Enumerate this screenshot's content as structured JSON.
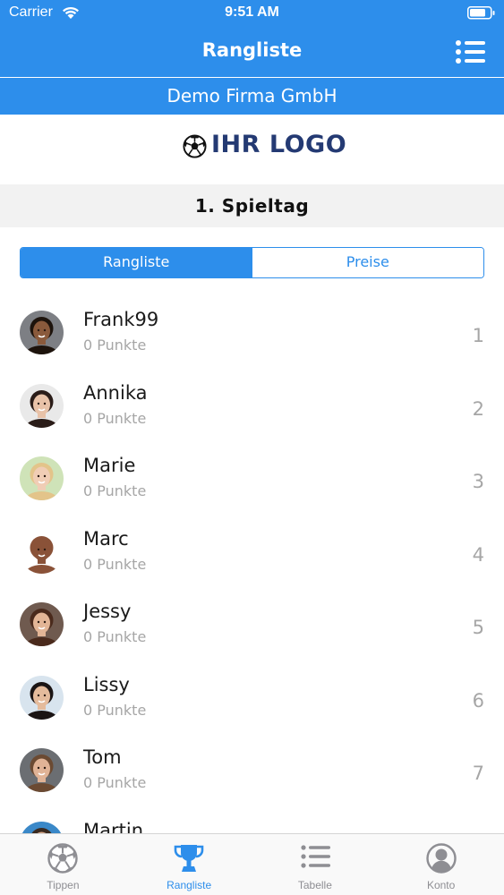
{
  "status_bar": {
    "carrier": "Carrier",
    "time": "9:51 AM"
  },
  "nav": {
    "title": "Rangliste",
    "menu_icon": "list-menu-icon"
  },
  "company": {
    "name": "Demo Firma GmbH"
  },
  "logo": {
    "text": "IHR LOGO",
    "icon": "soccer-ball-icon"
  },
  "matchday": {
    "title": "1. Spieltag"
  },
  "segments": [
    {
      "label": "Rangliste",
      "active": true
    },
    {
      "label": "Preise",
      "active": false
    }
  ],
  "players": [
    {
      "name": "Frank99",
      "points": "0 Punkte",
      "rank": "1",
      "skin": "#8a5a3c",
      "hair": "#1d130c",
      "bg": "#7d7f84"
    },
    {
      "name": "Annika",
      "points": "0 Punkte",
      "rank": "2",
      "skin": "#e8c2a8",
      "hair": "#2a1c18",
      "bg": "#e9e9e9"
    },
    {
      "name": "Marie",
      "points": "0 Punkte",
      "rank": "3",
      "skin": "#f0cdb5",
      "hair": "#e3c48a",
      "bg": "#cfe3b8"
    },
    {
      "name": "Marc",
      "points": "0 Punkte",
      "rank": "4",
      "skin": "#8a5238",
      "hair": "#8a5238",
      "bg": "#ffffff"
    },
    {
      "name": "Jessy",
      "points": "0 Punkte",
      "rank": "5",
      "skin": "#e2b596",
      "hair": "#4a2a1c",
      "bg": "#6f5a4f"
    },
    {
      "name": "Lissy",
      "points": "0 Punkte",
      "rank": "6",
      "skin": "#e4bb9c",
      "hair": "#1a1414",
      "bg": "#d8e4ee"
    },
    {
      "name": "Tom",
      "points": "0 Punkte",
      "rank": "7",
      "skin": "#e0b396",
      "hair": "#6b4a32",
      "bg": "#6b6e72"
    },
    {
      "name": "Martin",
      "points": "",
      "rank": "",
      "skin": "#d9a98a",
      "hair": "#3a2a20",
      "bg": "#3a88c8"
    }
  ],
  "tabs": [
    {
      "label": "Tippen",
      "icon": "soccer-ball-icon",
      "active": false
    },
    {
      "label": "Rangliste",
      "icon": "trophy-icon",
      "active": true
    },
    {
      "label": "Tabelle",
      "icon": "list-icon",
      "active": false
    },
    {
      "label": "Konto",
      "icon": "person-icon",
      "active": false
    }
  ],
  "colors": {
    "accent": "#2d8eeb",
    "logo_text": "#243a73",
    "muted_text": "#a6a6a6",
    "matchday_bg": "#f2f2f2"
  }
}
